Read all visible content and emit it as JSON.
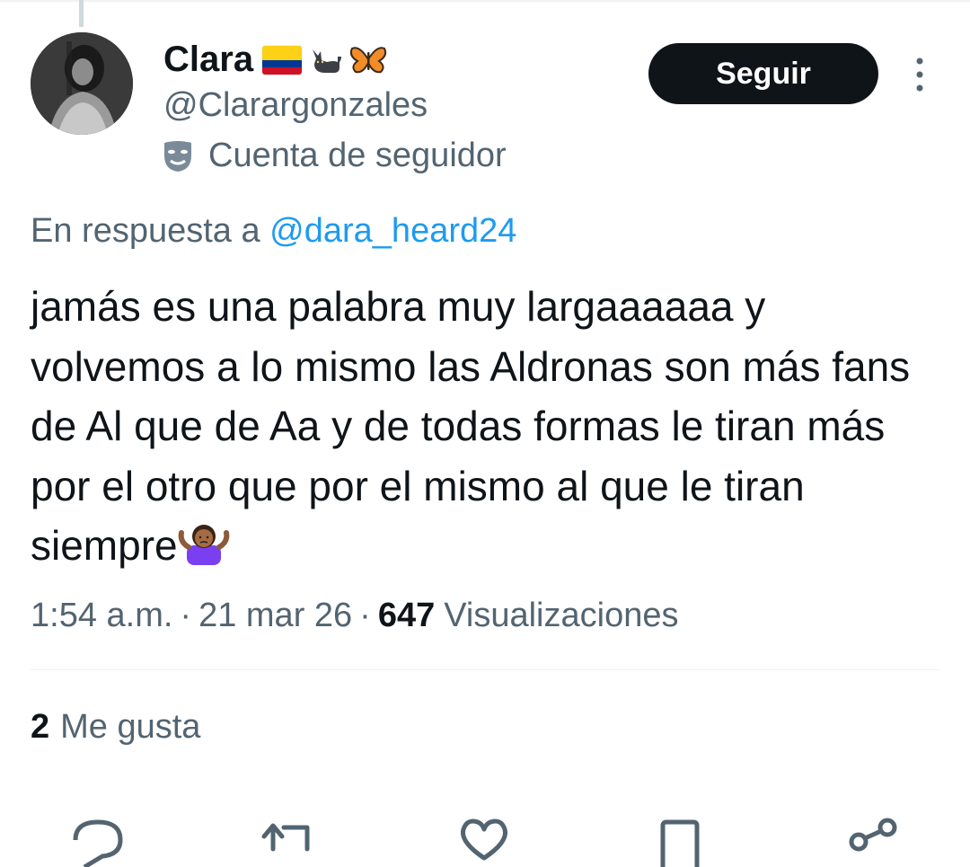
{
  "author": {
    "name": "Clara",
    "handle": "@Clarargonzales",
    "account_type": "Cuenta de seguidor",
    "emojis": [
      "colombia-flag",
      "black-cat",
      "butterfly"
    ]
  },
  "follow_button": {
    "label": "Seguir"
  },
  "reply_to": {
    "prefix": "En respuesta a",
    "mention": "@dara_heard24"
  },
  "tweet": {
    "text": "jamás es una palabra muy largaaaaaa y volvemos a lo mismo las Aldronas son más fans de Al que de Aa y de todas formas le tiran más por el otro que por el mismo al que le tiran siempre",
    "trailing_emoji": "person-shrugging"
  },
  "meta": {
    "time": "1:54 a.m.",
    "separator": "·",
    "date": "21 mar 26",
    "views_count": "647",
    "views_label": "Visualizaciones"
  },
  "stats": {
    "likes_count": "2",
    "likes_label": "Me gusta"
  },
  "actions": [
    "reply-icon",
    "retweet-icon",
    "like-icon",
    "bookmark-icon",
    "share-icon"
  ],
  "colors": {
    "text": "#0f1419",
    "secondary": "#536471",
    "link": "#1d9bf0",
    "button": "#0f1419"
  }
}
